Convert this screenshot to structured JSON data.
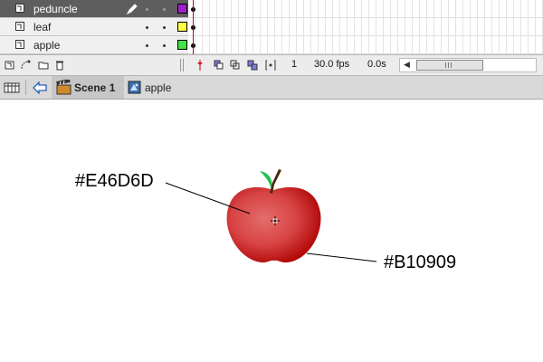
{
  "layers": [
    {
      "name": "peduncle",
      "selected": true,
      "color": "#A020C8"
    },
    {
      "name": "leaf",
      "selected": false,
      "color": "#FFFF44"
    },
    {
      "name": "apple",
      "selected": false,
      "color": "#44E044"
    }
  ],
  "timeline_toolbar": {
    "current_frame": "1",
    "frame_rate": "30.0 fps",
    "elapsed_time": "0.0s"
  },
  "breadcrumb": {
    "scene": "Scene 1",
    "symbol": "apple"
  },
  "stage": {
    "annotation_top_color": "#E46D6D",
    "annotation_bottom_color": "#B10909",
    "apple_light_color": "#E46D6D",
    "apple_dark_color": "#B10909",
    "leaf_color": "#22C050",
    "stem_color": "#4A2A0A"
  }
}
